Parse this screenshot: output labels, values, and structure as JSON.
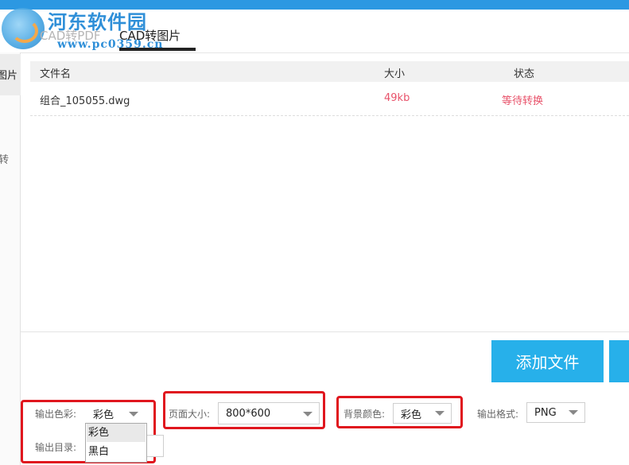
{
  "watermark": {
    "title": "河东软件园",
    "url": "www.pc0359.cn"
  },
  "tabs": [
    {
      "label": "CAD转PDF"
    },
    {
      "label": "CAD转图片"
    }
  ],
  "sidebar": {
    "item_active": "图片",
    "item_other": "转"
  },
  "table": {
    "headers": {
      "name": "文件名",
      "size": "大小",
      "status": "状态"
    },
    "rows": [
      {
        "name": "组合_105055.dwg",
        "size": "49kb",
        "status": "等待转换"
      }
    ]
  },
  "buttons": {
    "add_file": "添加文件"
  },
  "options": {
    "output_color": {
      "label": "输出色彩:",
      "value": "彩色",
      "options": [
        "彩色",
        "黑白"
      ]
    },
    "page_size": {
      "label": "页面大小:",
      "value": "800*600"
    },
    "background_color": {
      "label": "背景颜色:",
      "value": "彩色"
    },
    "output_format": {
      "label": "输出格式:",
      "value": "PNG"
    },
    "output_dir": {
      "label": "输出目录:"
    }
  },
  "colors": {
    "accent": "#27b0ea",
    "highlight_box": "#e0161e",
    "pending_text": "#e8526a",
    "topbar": "#2c98e2"
  }
}
